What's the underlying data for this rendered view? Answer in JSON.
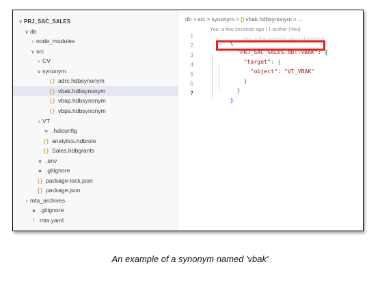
{
  "explorer": {
    "items": [
      {
        "label": "PRJ_SAC_SALES",
        "chevron": "∨",
        "icon": "",
        "indent": 0,
        "bold": true
      },
      {
        "label": "db",
        "chevron": "∨",
        "icon": "",
        "indent": 1
      },
      {
        "label": "node_modules",
        "chevron": "›",
        "icon": "",
        "indent": 2
      },
      {
        "label": "src",
        "chevron": "∨",
        "icon": "",
        "indent": 2
      },
      {
        "label": "CV",
        "chevron": "›",
        "icon": "",
        "indent": 3
      },
      {
        "label": "synonym",
        "chevron": "∨",
        "icon": "",
        "indent": 3
      },
      {
        "label": "adrc.hdbsynonym",
        "chevron": "",
        "icon": "{}",
        "indent": 4
      },
      {
        "label": "vbak.hdbsynonym",
        "chevron": "",
        "icon": "{}",
        "indent": 4,
        "selected": true
      },
      {
        "label": "vbap.hdbsynonym",
        "chevron": "",
        "icon": "{}",
        "indent": 4
      },
      {
        "label": "vbpa.hdbsynonym",
        "chevron": "",
        "icon": "{}",
        "indent": 4
      },
      {
        "label": "VT",
        "chevron": "›",
        "icon": "",
        "indent": 3
      },
      {
        "label": ".hdiconfig",
        "chevron": "",
        "icon": "≡",
        "indent": 3,
        "gray": true
      },
      {
        "label": "analytics.hdbrole",
        "chevron": "",
        "icon": "{}",
        "indent": 3
      },
      {
        "label": "Sales.hdbgrants",
        "chevron": "",
        "icon": "{}",
        "indent": 3
      },
      {
        "label": ".env",
        "chevron": "",
        "icon": "⚙",
        "indent": 2,
        "gray": true
      },
      {
        "label": ".gitignore",
        "chevron": "",
        "icon": "◆",
        "indent": 2,
        "gray": true
      },
      {
        "label": "package-lock.json",
        "chevron": "",
        "icon": "{}",
        "indent": 2
      },
      {
        "label": "package.json",
        "chevron": "",
        "icon": "{}",
        "indent": 2
      },
      {
        "label": "mta_archives",
        "chevron": "›",
        "icon": "",
        "indent": 1
      },
      {
        "label": ".gitignore",
        "chevron": "",
        "icon": "◆",
        "indent": 1,
        "gray": true
      },
      {
        "label": "mta.yaml",
        "chevron": "",
        "icon": "!",
        "indent": 1,
        "gray": true
      }
    ]
  },
  "editor": {
    "breadcrumb": [
      "db",
      ">",
      "src",
      ">",
      "synonym",
      ">",
      "{}",
      "vbak.hdbsynonym",
      ">",
      "..."
    ],
    "blame": "You, a few seconds ago | 1 author (You)",
    "ghost_blame": "You, a few seconds ago • Uncommit",
    "line_numbers": [
      "1",
      "2",
      "3",
      "4",
      "5",
      "6",
      "7"
    ],
    "active_line": "7",
    "code": {
      "l1_brace": "{",
      "l2_key": "\"PRJ_SAC_SALES.db::VBAK\"",
      "l2_colon": ": {",
      "l3_key": "\"target\"",
      "l3_colon": ": {",
      "l4_key": "\"object\"",
      "l4_colon": ": ",
      "l4_value": "\"VT_VBAK\"",
      "l5_brace": "}",
      "l6_brace": "}",
      "l7_brace": "}"
    }
  },
  "caption": "An example of a synonym named 'vbak'",
  "colors": {
    "highlight_box": "#e8201c",
    "selected_row": "#e4e6f1",
    "string": "#a31515"
  }
}
